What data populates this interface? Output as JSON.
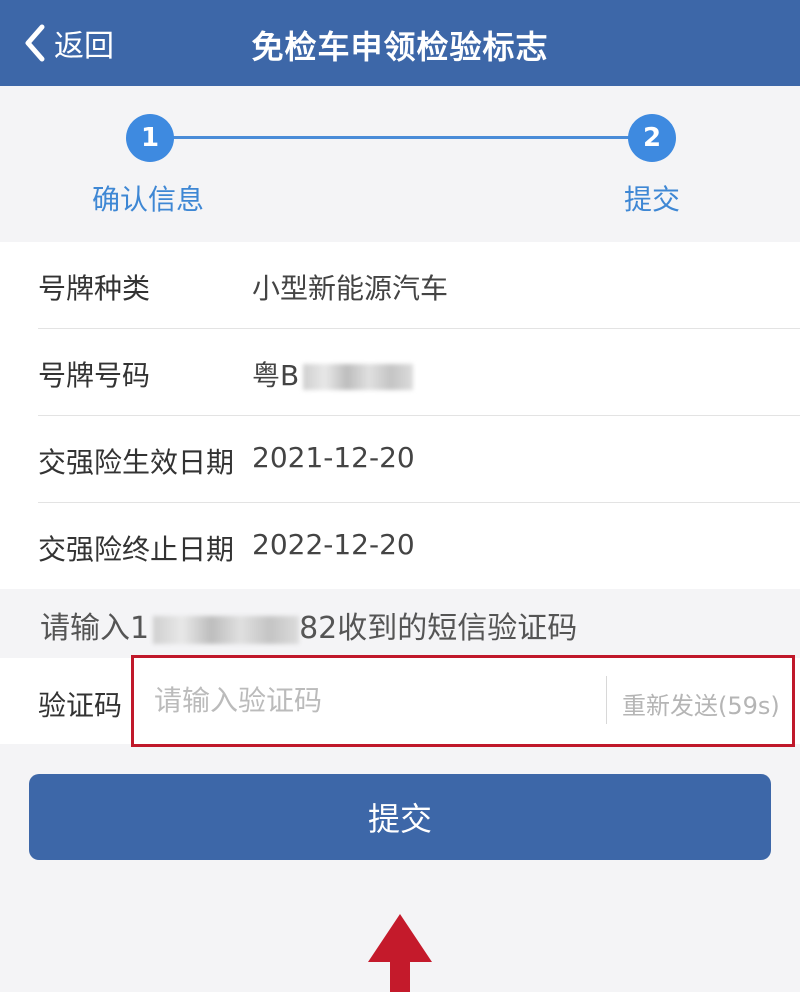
{
  "header": {
    "back_label": "返回",
    "title": "免检车申领检验标志"
  },
  "steps": [
    {
      "number": "1",
      "label": "确认信息"
    },
    {
      "number": "2",
      "label": "提交"
    }
  ],
  "info_rows": [
    {
      "label": "号牌种类",
      "value": "小型新能源汽车"
    },
    {
      "label": "号牌号码",
      "value": "粤B"
    },
    {
      "label": "交强险生效日期",
      "value": "2021-12-20"
    },
    {
      "label": "交强险终止日期",
      "value": "2022-12-20"
    }
  ],
  "sms_hint": {
    "prefix": "请输入1",
    "suffix": "82收到的短信验证码"
  },
  "verification": {
    "label": "验证码",
    "placeholder": "请输入验证码",
    "value": "",
    "resend_label": "重新发送(59s)"
  },
  "submit_label": "提交",
  "colors": {
    "header_bg": "#3d67a8",
    "step_blue": "#3e8ae0",
    "highlight_red": "#c0182a",
    "arrow_red": "#c41a2b"
  },
  "icons": {
    "back": "chevron-left-icon",
    "annotation_arrow": "arrow-up-icon"
  }
}
